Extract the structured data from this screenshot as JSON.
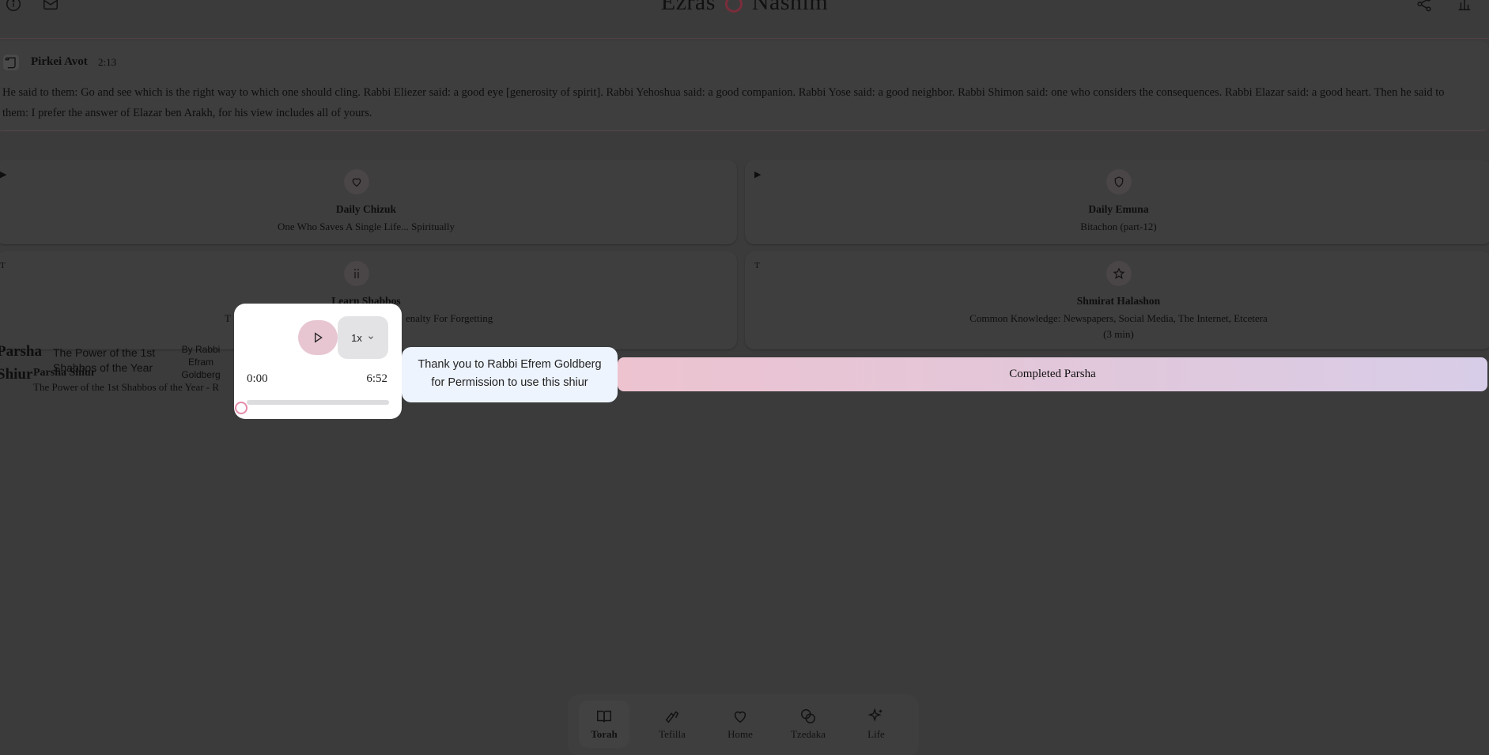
{
  "header": {
    "brand_left": "Ezras",
    "brand_right": "Nashim",
    "icons": [
      "info-icon",
      "mail-icon",
      "share-icon",
      "chart-icon"
    ]
  },
  "pirkei": {
    "title": "Pirkei Avot",
    "ref": "2:13",
    "text": "He said to them: Go and see which is the right way to which one should cling. Rabbi Eliezer said: a good eye [generosity of spirit]. Rabbi Yehoshua said: a good companion. Rabbi Yose said: a good neighbor. Rabbi Shimon said: one who considers the consequences. Rabbi Elazar said: a good heart. Then he said to them: I prefer the answer of Elazar ben Arakh, for his view includes all of yours."
  },
  "cards": {
    "chizuk": {
      "corner": "▶",
      "title": "Daily Chizuk",
      "subtitle": "One Who Saves A Single Life... Spiritually"
    },
    "emuna": {
      "corner": "▶",
      "title": "Daily Emuna",
      "subtitle": "Bitachon (part-12)"
    },
    "shabbos": {
      "corner": "T",
      "title": "Learn Shabbos",
      "subtitle_left": "T",
      "subtitle_right": "enalty For Forgetting"
    },
    "halashon": {
      "corner": "T",
      "title": "Shmirat Halashon",
      "subtitle": "Common Knowledge: Newspapers, Social Media, The Internet, Etcetera",
      "duration": "(3 min)"
    }
  },
  "parsha": {
    "big1": "Parsha",
    "big2": "Shiur",
    "overlay_title": "The Power of the 1st Shabbos of the Year",
    "overlay_author": "By Rabbi Efram Goldberg",
    "label": "Parsha Shiur",
    "subtitle": "The Power of the 1st Shabbos of the Year - R"
  },
  "player": {
    "speed": "1x",
    "current_time": "0:00",
    "duration": "6:52",
    "progress": 0
  },
  "thanks": {
    "line1": "Thank you to Rabbi Efrem Goldberg",
    "line2": "for Permission to use this shiur"
  },
  "completed_label": "Completed Parsha",
  "nav": [
    {
      "label": "Torah",
      "icon": "book-icon",
      "active": true
    },
    {
      "label": "Tefilla",
      "icon": "hands-icon",
      "active": false
    },
    {
      "label": "Home",
      "icon": "heart-icon",
      "active": false
    },
    {
      "label": "Tzedaka",
      "icon": "coins-icon",
      "active": false
    },
    {
      "label": "Life",
      "icon": "sparkles-icon",
      "active": false
    }
  ]
}
